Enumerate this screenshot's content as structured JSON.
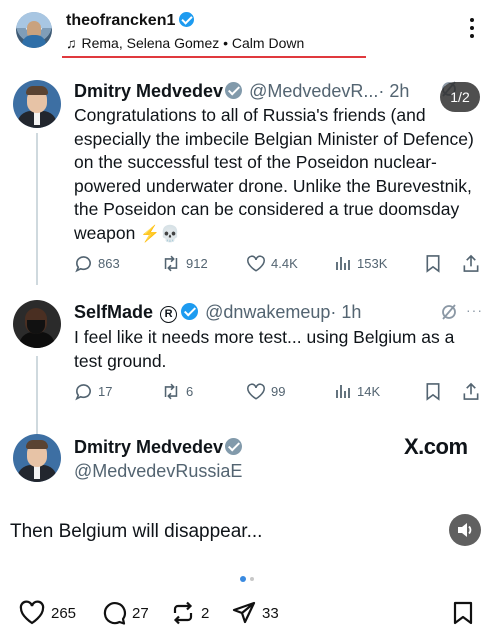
{
  "post_header": {
    "username": "theofrancken1",
    "music_text": "Rema, Selena Gomez • Calm Down"
  },
  "page_indicator": "1/2",
  "tweets": [
    {
      "name": "Dmitry Medvedev",
      "handle": "@MedvedevR...",
      "time": "· 2h",
      "body": "Congratulations to all of Russia's friends (and especially the imbecile Belgian Minister of Defence) on the successful test of the Poseidon nuclear-powered underwater drone. Unlike the Burevestnik, the Poseidon can be considered a true doomsday weapon",
      "emojis": "⚡💀",
      "replies": "863",
      "reposts": "912",
      "likes": "4.4K",
      "views": "153K"
    },
    {
      "name": "SelfMade",
      "handle": "@dnwakemeup",
      "time": "· 1h",
      "more": "···",
      "body": "I feel like it needs more test... using Belgium as a test ground.",
      "replies": "17",
      "reposts": "6",
      "likes": "99",
      "views": "14K"
    },
    {
      "name": "Dmitry Medvedev",
      "handle": "@MedvedevRussiaE"
    }
  ],
  "watermark": "X.com",
  "caption": "Then Belgium will disappear...",
  "post_actions": {
    "likes": "265",
    "comments": "27",
    "reposts": "2",
    "shares": "33"
  },
  "colors": {
    "accent_blue": "#1d9bf0",
    "muted_text": "#536471",
    "underline_red": "#e0393e"
  },
  "icons": [
    "verified-badge-icon",
    "music-note-icon",
    "more-options-icon",
    "reply-icon",
    "repost-icon",
    "like-icon",
    "views-icon",
    "bookmark-icon",
    "share-icon",
    "grok-icon",
    "speaker-icon",
    "heart-icon",
    "comment-icon",
    "send-icon",
    "save-icon"
  ]
}
